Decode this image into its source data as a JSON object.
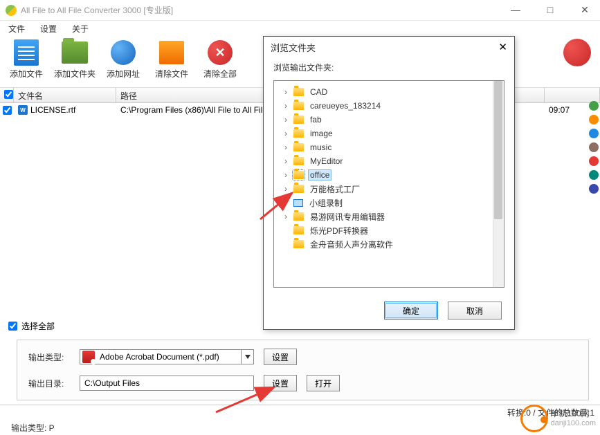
{
  "window": {
    "title": "All File to All File Converter 3000 [专业版]"
  },
  "menu": {
    "file": "文件",
    "settings": "设置",
    "about": "关于"
  },
  "toolbar": {
    "addfile": "添加文件",
    "addfolder": "添加文件夹",
    "addurl": "添加网址",
    "clear": "清除文件",
    "clearall": "清除全部"
  },
  "list": {
    "col_name": "文件名",
    "col_path": "路径",
    "row": {
      "name": "LICENSE.rtf",
      "path": "C:\\Program Files (x86)\\All File to All File C",
      "time": "09:07"
    },
    "select_all": "选择全部"
  },
  "form": {
    "type_label": "输出类型:",
    "type_value": "Adobe Acrobat Document (*.pdf)",
    "dir_label": "输出目录:",
    "dir_value": "C:\\Output Files",
    "btn_set": "设置",
    "btn_open": "打开"
  },
  "status": {
    "convert": "转换:0 / 文件的总数目:1",
    "output_type": "输出类型: P"
  },
  "dialog": {
    "title": "浏览文件夹",
    "subtitle": "浏览输出文件夹:",
    "items": {
      "cad": "CAD",
      "careueyes": "careueyes_183214",
      "fab": "fab",
      "image": "image",
      "music": "music",
      "myeditor": "MyEditor",
      "office": "office",
      "wngsgc": "万能格式工厂",
      "xzlz": "小组录制",
      "yywx": "易游网讯专用编辑器",
      "sgpdf": "烁光PDF转换器",
      "jzyp": "金舟音频人声分离软件"
    },
    "ok": "确定",
    "cancel": "取消"
  },
  "watermark": {
    "line1": "单机100网",
    "line2": "danji100.com"
  }
}
